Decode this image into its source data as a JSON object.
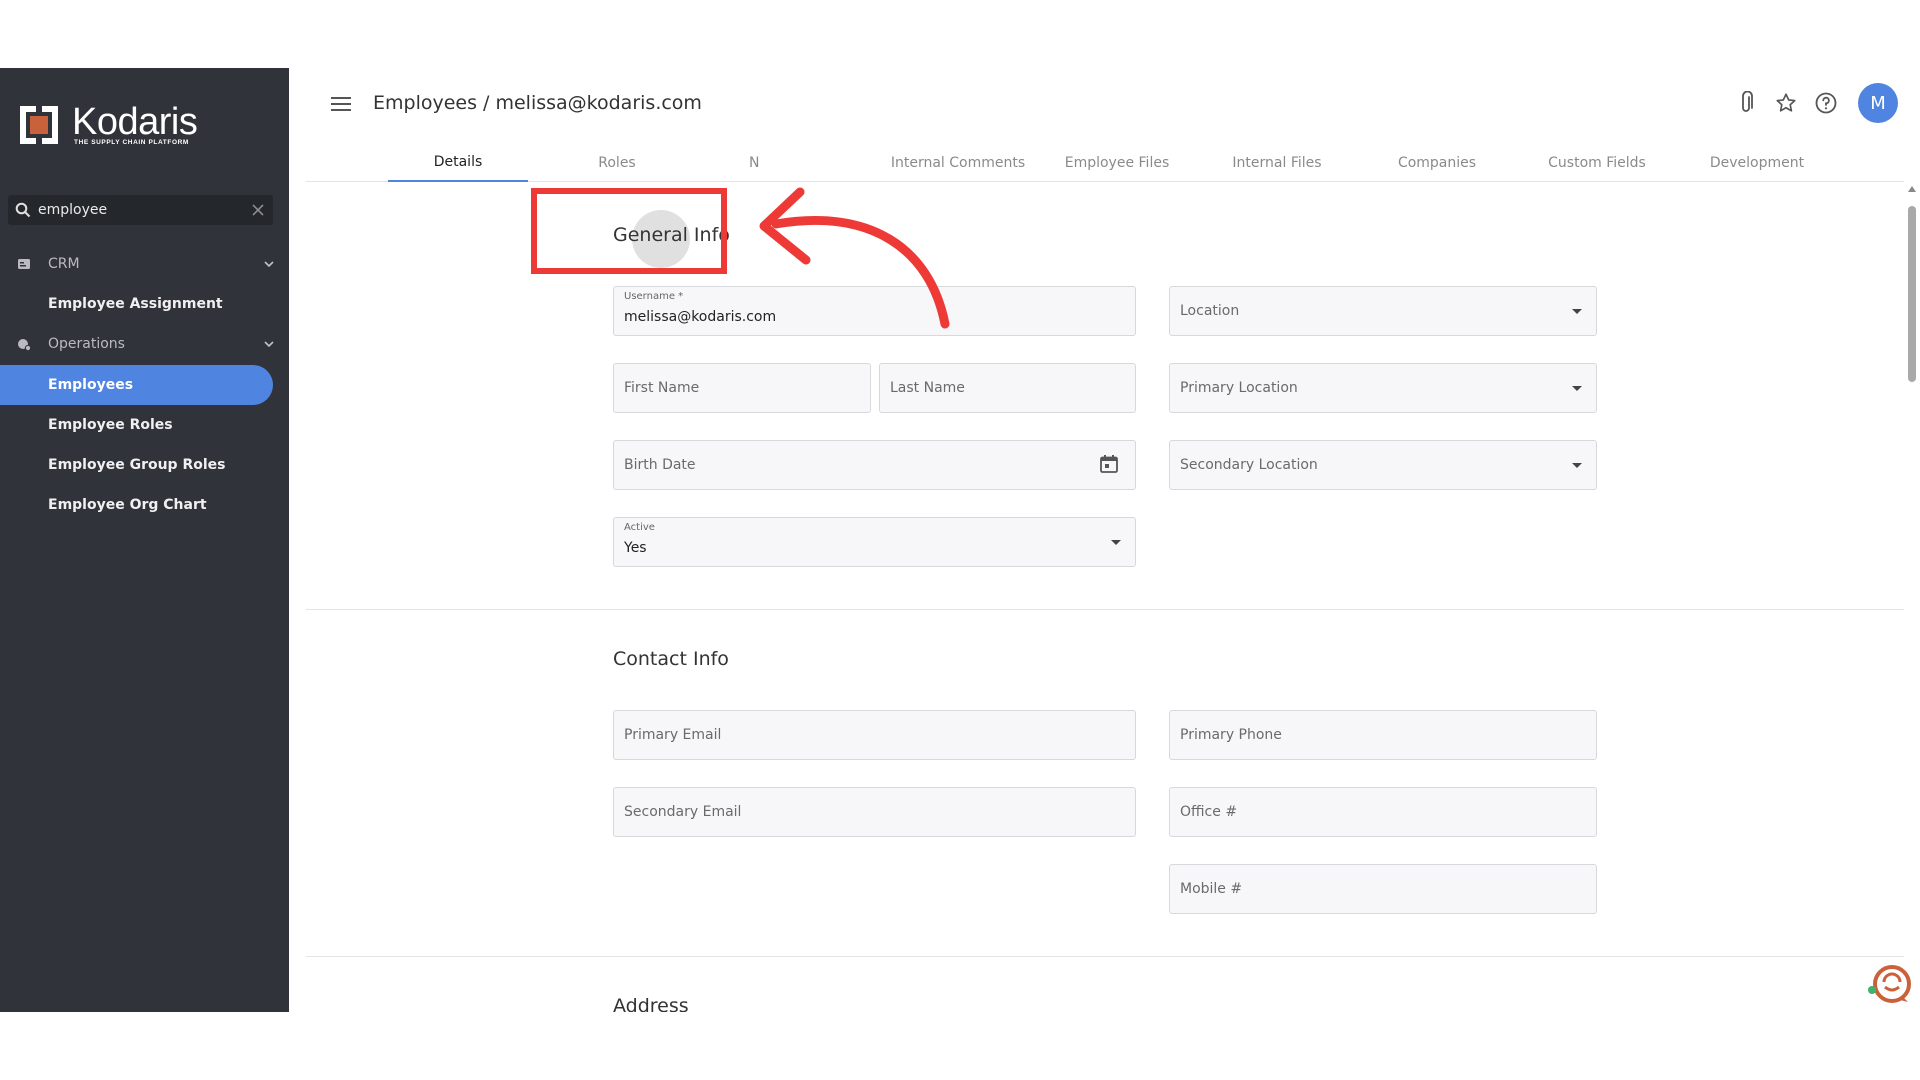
{
  "brand": {
    "name": "Kodaris",
    "tagline": "THE SUPPLY CHAIN PLATFORM"
  },
  "sidebar": {
    "search": {
      "value": "employee",
      "placeholder": ""
    },
    "groups": [
      {
        "label": "CRM",
        "items": [
          "Employee Assignment"
        ]
      },
      {
        "label": "Operations",
        "items": [
          "Employees",
          "Employee Roles",
          "Employee Group Roles",
          "Employee Org Chart"
        ]
      }
    ],
    "active_item": "Employees"
  },
  "header": {
    "title": "Employees / melissa@kodaris.com",
    "avatar_initial": "M"
  },
  "tabs": [
    "Details",
    "Roles",
    "N",
    "Internal Comments",
    "Employee Files",
    "Internal Files",
    "Companies",
    "Custom Fields",
    "Development"
  ],
  "active_tab": "Details",
  "general_info": {
    "title": "General Info",
    "username_label": "Username *",
    "username_value": "melissa@kodaris.com",
    "first_name": "First Name",
    "last_name": "Last Name",
    "birth_date": "Birth Date",
    "active_label": "Active",
    "active_value": "Yes",
    "location": "Location",
    "primary_location": "Primary Location",
    "secondary_location": "Secondary Location"
  },
  "contact_info": {
    "title": "Contact Info",
    "primary_email": "Primary Email",
    "secondary_email": "Secondary Email",
    "primary_phone": "Primary Phone",
    "office": "Office #",
    "mobile": "Mobile #"
  },
  "address": {
    "title": "Address"
  },
  "colors": {
    "accent": "#4f84e0",
    "annotation": "#ee3a36",
    "sidebar": "#30333a"
  }
}
